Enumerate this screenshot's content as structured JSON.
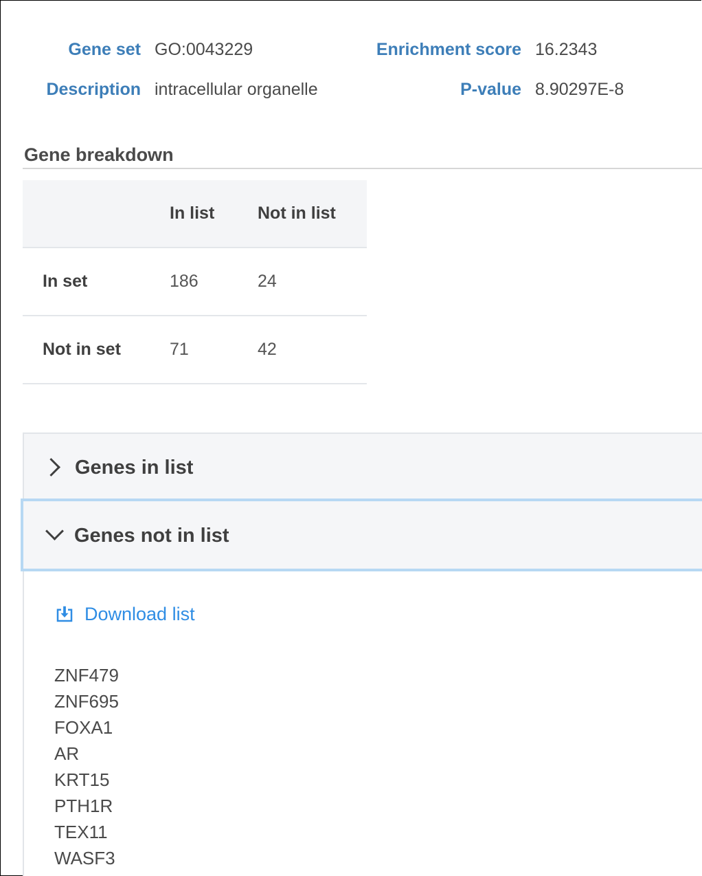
{
  "summary": {
    "gene_set_label": "Gene set",
    "gene_set_value": "GO:0043229",
    "description_label": "Description",
    "description_value": "intracellular organelle",
    "enrichment_label": "Enrichment score",
    "enrichment_value": "16.2343",
    "pvalue_label": "P-value",
    "pvalue_value": "8.90297E-8"
  },
  "breakdown": {
    "title": "Gene breakdown",
    "columns": [
      "",
      "In list",
      "Not in list"
    ],
    "rows": [
      {
        "label": "In set",
        "in_list": "186",
        "not_in_list": "24"
      },
      {
        "label": "Not in set",
        "in_list": "71",
        "not_in_list": "42"
      }
    ]
  },
  "accordion": {
    "genes_in_list": {
      "label": "Genes in list",
      "expanded": false,
      "icon": "chevron-right-icon"
    },
    "genes_not_in_list": {
      "label": "Genes not in list",
      "expanded": true,
      "icon": "chevron-down-icon"
    }
  },
  "download": {
    "label": "Download list",
    "icon": "download-icon",
    "color": "#2f8de4"
  },
  "genes_not_in_list": [
    "ZNF479",
    "ZNF695",
    "FOXA1",
    "AR",
    "KRT15",
    "PTH1R",
    "TEX11",
    "WASF3"
  ],
  "colors": {
    "label_blue": "#3d7eb8",
    "link_blue": "#2f8de4",
    "focus_border": "#b7d8f3",
    "header_bg": "#f4f5f7"
  }
}
